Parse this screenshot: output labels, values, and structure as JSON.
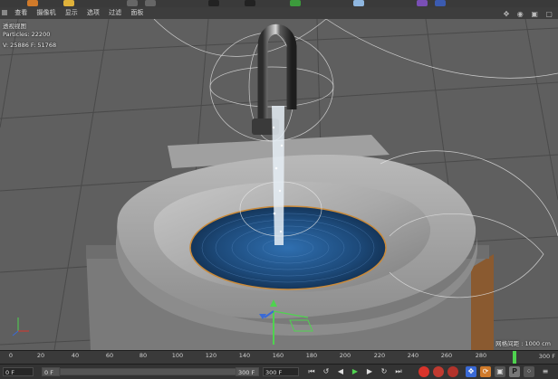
{
  "menubar": {
    "items": [
      "查看",
      "摄像机",
      "显示",
      "选项",
      "过滤",
      "面板"
    ],
    "right_icons": "✥ ◉ ▣ ▢"
  },
  "viewport": {
    "hud_title": "透视视图",
    "particles": "Particles: 22200",
    "stats": "V: 25886 F: 51768",
    "grid_spacing": "网格间距 : 1000 cm"
  },
  "timeline": {
    "ticks": [
      "0",
      "20",
      "40",
      "60",
      "80",
      "100",
      "120",
      "140",
      "160",
      "180",
      "200",
      "220",
      "240",
      "260",
      "280"
    ],
    "end_label": "300 F",
    "current_frame_fraction": 0.933
  },
  "controls": {
    "start_frame": "0 F",
    "min_frame": "0 F",
    "max_frame": "300 F",
    "end_frame": "300 F"
  },
  "colors": {
    "playhead": "#4fd34f",
    "water": "#1d4a7a",
    "record": "#d9342b"
  }
}
